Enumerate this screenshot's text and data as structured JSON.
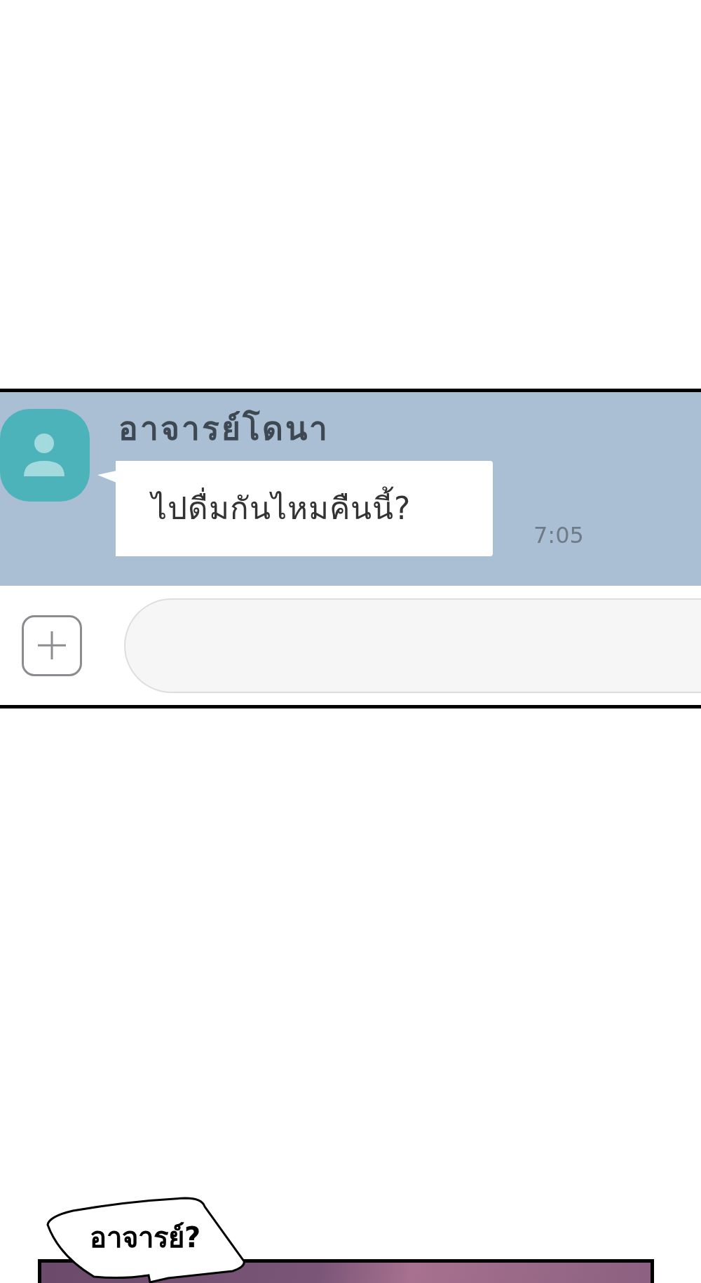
{
  "chat": {
    "contact_name": "อาจารย์โดนา",
    "messages": [
      {
        "text": "ไปดื่มกันไหมคืนนี้?",
        "time": "7:05"
      }
    ]
  },
  "comic": {
    "speech_bubble": "อาจารย์?"
  }
}
